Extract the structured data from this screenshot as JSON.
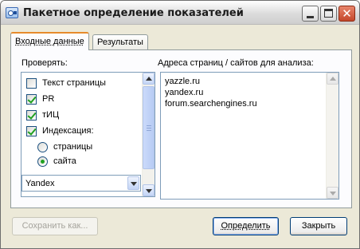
{
  "window": {
    "title": "Пакетное определение показателей",
    "close_glyph": "✕"
  },
  "tabs": [
    {
      "label": "Входные данные",
      "active": true
    },
    {
      "label": "Результаты",
      "active": false
    }
  ],
  "check_section": {
    "label": "Проверять:",
    "items": [
      {
        "label": "Текст страницы",
        "checked": false
      },
      {
        "label": "PR",
        "checked": true
      },
      {
        "label": "тИЦ",
        "checked": true
      },
      {
        "label": "Индексация:",
        "checked": true
      }
    ],
    "radios": [
      {
        "label": "страницы",
        "selected": false
      },
      {
        "label": "сайта",
        "selected": true
      }
    ],
    "engine_select": {
      "value": "Yandex"
    }
  },
  "urls_section": {
    "label": "Адреса страниц / сайтов для анализа:",
    "lines": [
      "yazzle.ru",
      "yandex.ru",
      "forum.searchengines.ru"
    ]
  },
  "buttons": {
    "save_label": "Сохранить как...",
    "define_label": "Определить",
    "close_label": "Закрыть"
  },
  "colors": {
    "window_bg": "#ece9d8",
    "tab_accent": "#e68b2c",
    "check_green": "#21a121",
    "close_red": "#c4472b"
  }
}
